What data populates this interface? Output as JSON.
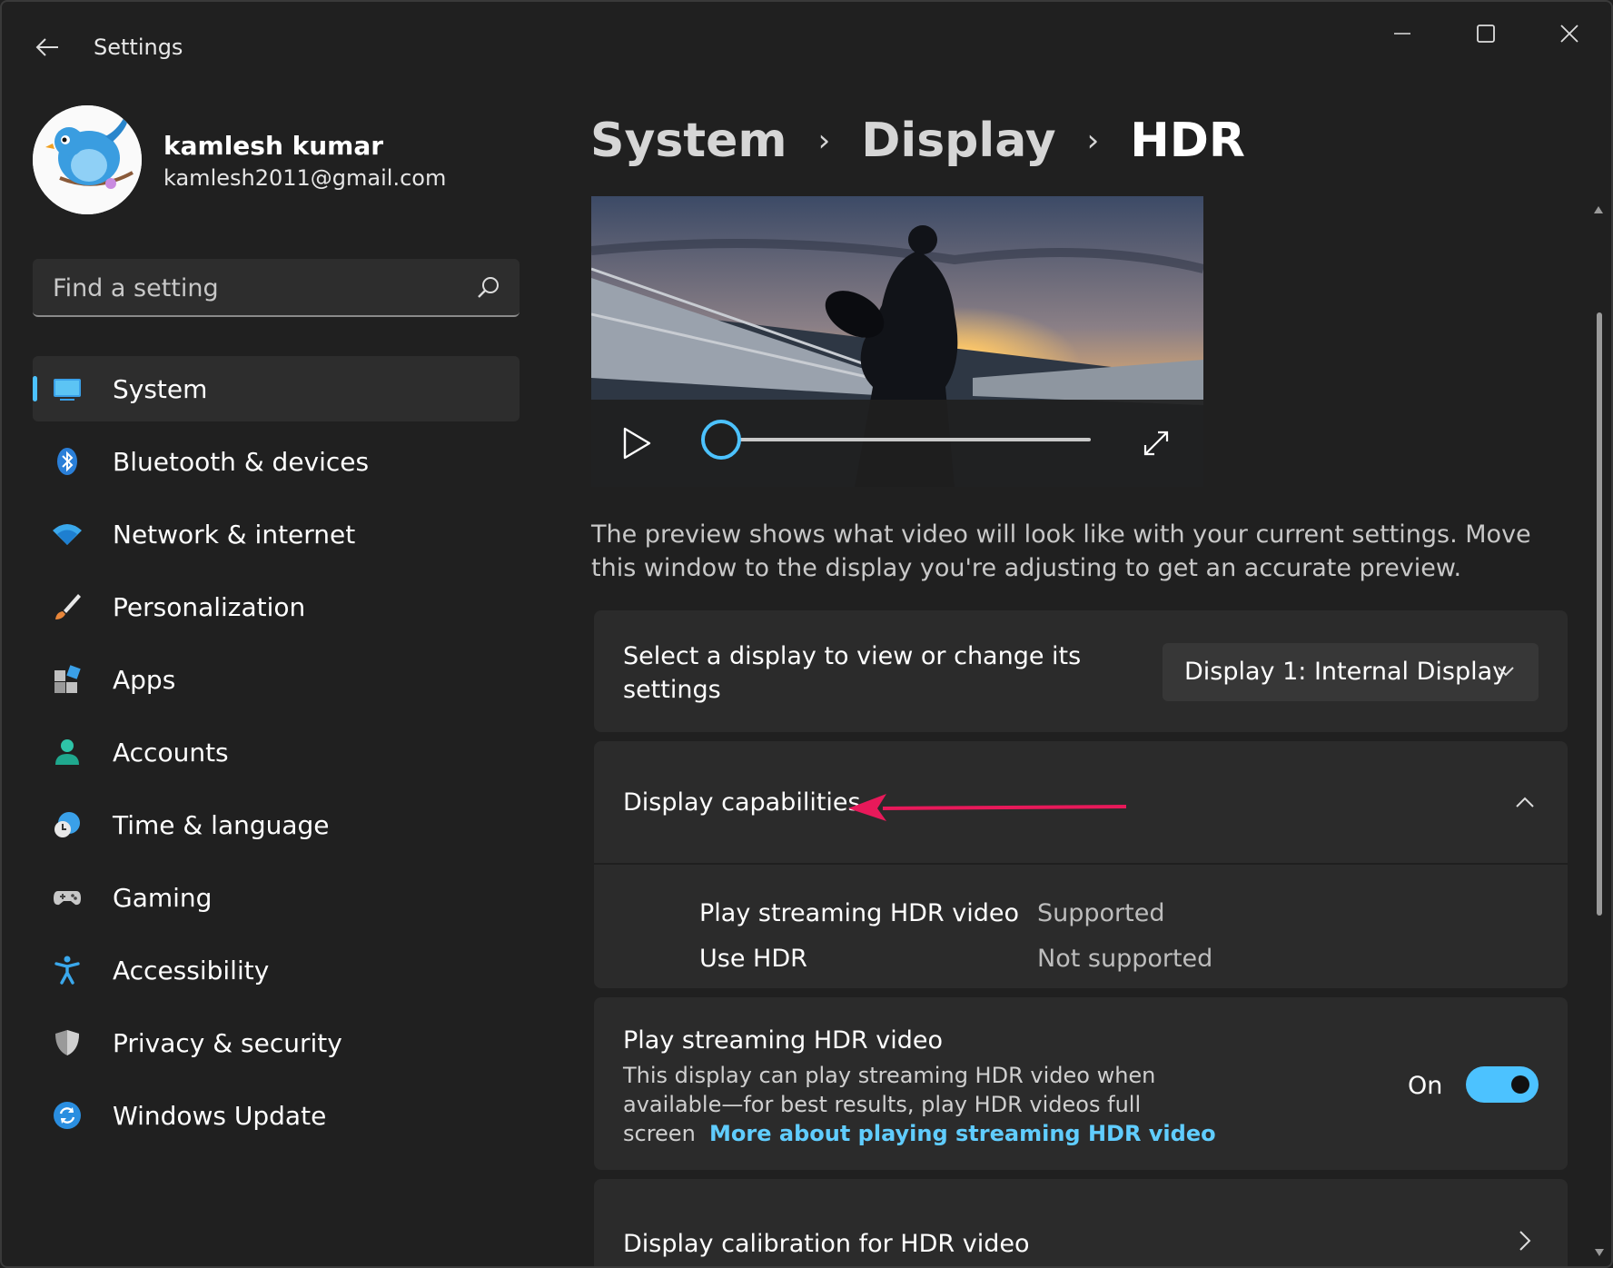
{
  "window": {
    "title": "Settings",
    "back_icon": "back-arrow-icon",
    "controls": [
      "minimize-icon",
      "maximize-icon",
      "close-icon"
    ]
  },
  "profile": {
    "name": "kamlesh kumar",
    "email": "kamlesh2011@gmail.com"
  },
  "search": {
    "placeholder": "Find a setting",
    "value": ""
  },
  "sidebar": {
    "accent": "#4cc2ff",
    "items": [
      {
        "label": "System",
        "icon": "monitor-icon",
        "active": true
      },
      {
        "label": "Bluetooth & devices",
        "icon": "bluetooth-icon"
      },
      {
        "label": "Network & internet",
        "icon": "wifi-icon"
      },
      {
        "label": "Personalization",
        "icon": "brush-icon"
      },
      {
        "label": "Apps",
        "icon": "apps-icon"
      },
      {
        "label": "Accounts",
        "icon": "person-icon"
      },
      {
        "label": "Time & language",
        "icon": "clock-globe-icon"
      },
      {
        "label": "Gaming",
        "icon": "gamepad-icon"
      },
      {
        "label": "Accessibility",
        "icon": "accessibility-icon"
      },
      {
        "label": "Privacy & security",
        "icon": "shield-icon"
      },
      {
        "label": "Windows Update",
        "icon": "update-icon"
      }
    ]
  },
  "breadcrumb": {
    "items": [
      "System",
      "Display",
      "HDR"
    ]
  },
  "video_preview": {
    "progress": 0
  },
  "preview_description": "The preview shows what video will look like with your current settings. Move this window to the display you're adjusting to get an accurate preview.",
  "display_select": {
    "label": "Select a display to view or change its settings",
    "selected": "Display 1: Internal Display"
  },
  "display_capabilities": {
    "title": "Display capabilities",
    "expanded": true,
    "rows": [
      {
        "key": "Play streaming HDR video",
        "value": "Supported"
      },
      {
        "key": "Use HDR",
        "value": "Not supported"
      }
    ]
  },
  "streaming_hdr": {
    "title": "Play streaming HDR video",
    "description": "This display can play streaming HDR video when available—for best results, play HDR videos full screen",
    "link": "More about playing streaming HDR video",
    "toggle_label": "On",
    "toggle_on": true
  },
  "calibration": {
    "title": "Display calibration for HDR video"
  }
}
